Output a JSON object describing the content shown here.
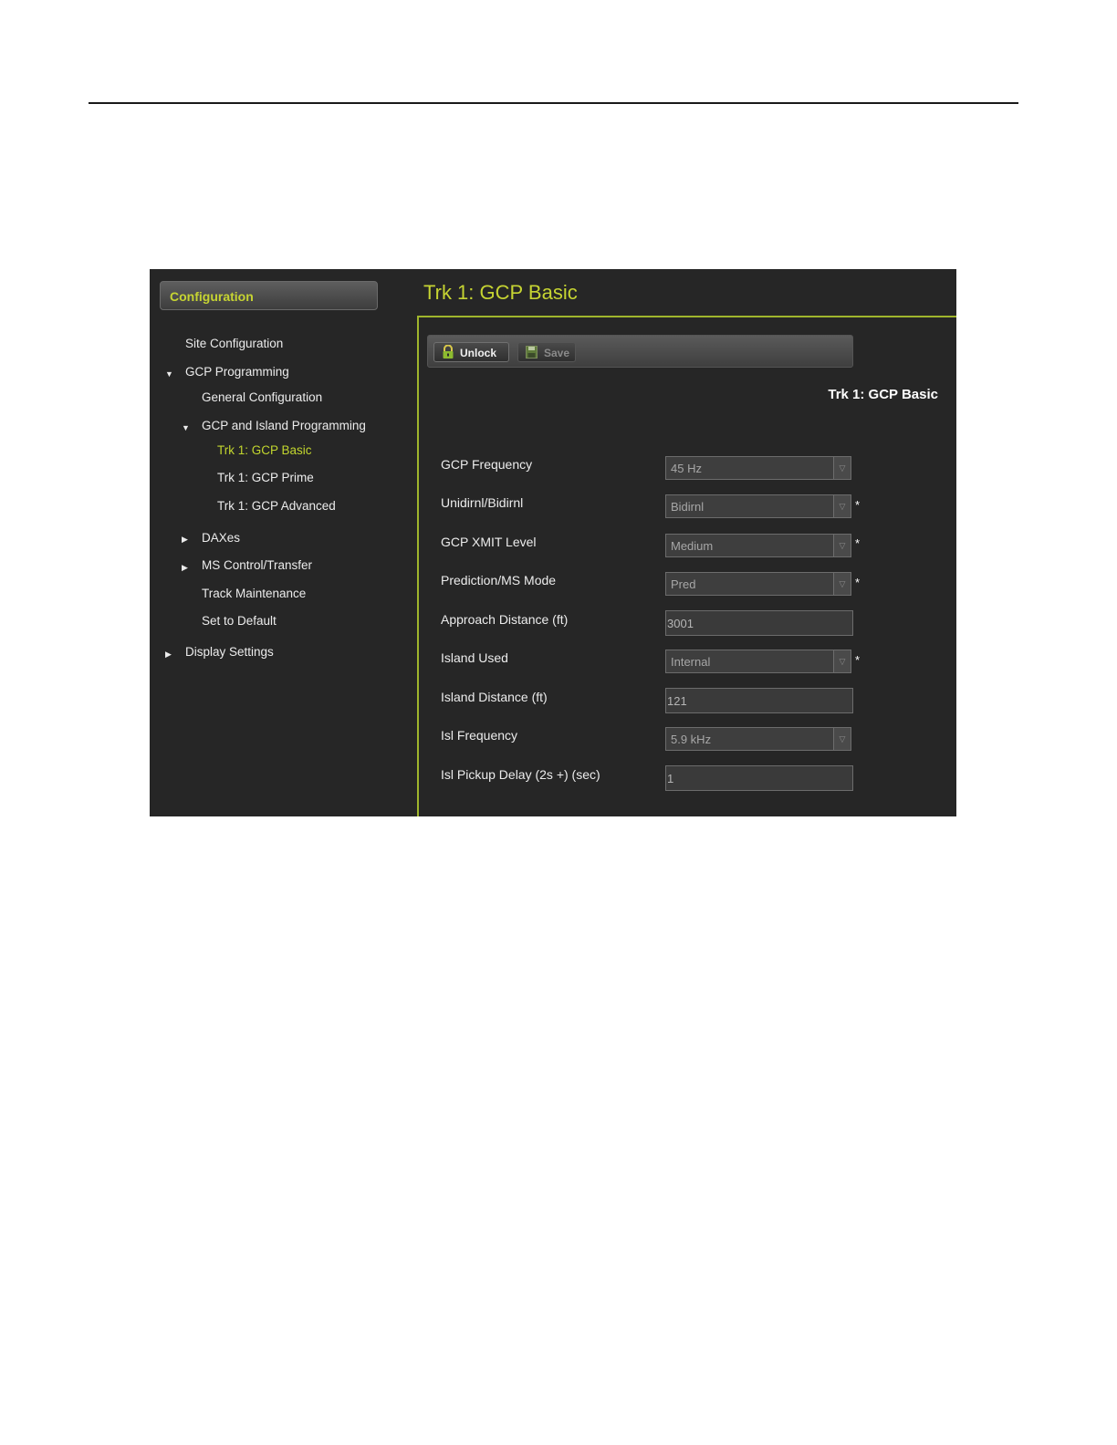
{
  "sidebar": {
    "header": "Configuration",
    "items": [
      {
        "label": "Site Configuration"
      },
      {
        "label": "GCP Programming"
      },
      {
        "label": "General Configuration"
      },
      {
        "label": "GCP and Island Programming"
      },
      {
        "label": "Trk 1: GCP Basic"
      },
      {
        "label": "Trk 1: GCP Prime"
      },
      {
        "label": "Trk 1: GCP Advanced"
      },
      {
        "label": "DAXes"
      },
      {
        "label": "MS Control/Transfer"
      },
      {
        "label": "Track Maintenance"
      },
      {
        "label": "Set to Default"
      },
      {
        "label": "Display Settings"
      }
    ]
  },
  "main": {
    "title": "Trk 1: GCP Basic",
    "section_title": "Trk 1: GCP Basic",
    "toolbar": {
      "unlock_label": "Unlock",
      "save_label": "Save"
    },
    "fields": [
      {
        "label": "GCP Frequency",
        "value": "45 Hz",
        "type": "select",
        "required": ""
      },
      {
        "label": "Unidirnl/Bidirnl",
        "value": "Bidirnl",
        "type": "select",
        "required": "*"
      },
      {
        "label": "GCP XMIT Level",
        "value": "Medium",
        "type": "select",
        "required": "*"
      },
      {
        "label": "Prediction/MS Mode",
        "value": "Pred",
        "type": "select",
        "required": "*"
      },
      {
        "label": "Approach Distance (ft)",
        "value": "3001",
        "type": "text",
        "required": ""
      },
      {
        "label": "Island Used",
        "value": "Internal",
        "type": "select",
        "required": "*"
      },
      {
        "label": "Island Distance (ft)",
        "value": "121",
        "type": "text",
        "required": ""
      },
      {
        "label": "Isl Frequency",
        "value": "5.9 kHz",
        "type": "select",
        "required": ""
      },
      {
        "label": "Isl Pickup Delay (2s +) (sec)",
        "value": "1",
        "type": "text",
        "required": ""
      }
    ]
  },
  "colors": {
    "accent": "#c6d432",
    "background": "#262626",
    "panel_border": "#9fb52c"
  }
}
